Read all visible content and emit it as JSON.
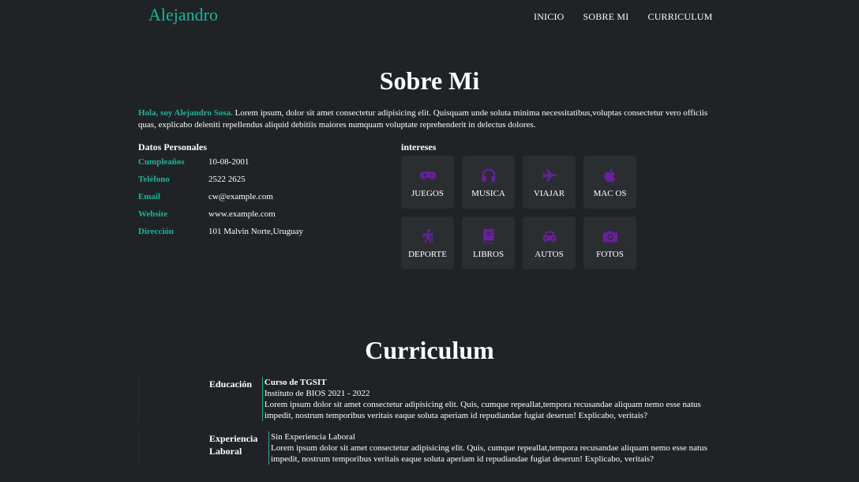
{
  "header": {
    "brand": "Alejandro",
    "nav": [
      "INICIO",
      "SOBRE MI",
      "CURRICULUM"
    ]
  },
  "about": {
    "title": "Sobre Mi",
    "greeting": "Hola, soy Alejandro Sosa.",
    "intro": " Lorem ipsum, dolor sit amet consectetur adipisicing elit. Quisquam unde soluta minima necessitatibus,voluptas consectetur vero officiis quas, explicabo deleniti repellendus aliquid debitiis maiores numquam voluptate reprehenderit in delectus dolores.",
    "personal_heading": "Datos Personales",
    "personal": [
      {
        "key": "Cumpleaños",
        "value": "10-08-2001"
      },
      {
        "key": "Teléfono",
        "value": "2522 2625"
      },
      {
        "key": "Email",
        "value": "cw@example.com"
      },
      {
        "key": "Website",
        "value": "www.example.com"
      },
      {
        "key": "Dirección",
        "value": "101 Malvin Norte,Uruguay"
      }
    ],
    "interests_heading": "intereses",
    "interests": [
      {
        "label": "JUEGOS",
        "icon": "gamepad-icon"
      },
      {
        "label": "MUSICA",
        "icon": "headphones-icon"
      },
      {
        "label": "VIAJAR",
        "icon": "plane-icon"
      },
      {
        "label": "MAC OS",
        "icon": "apple-icon"
      },
      {
        "label": "DEPORTE",
        "icon": "hiking-icon"
      },
      {
        "label": "LIBROS",
        "icon": "book-icon"
      },
      {
        "label": "AUTOS",
        "icon": "car-icon"
      },
      {
        "label": "FOTOS",
        "icon": "camera-icon"
      }
    ],
    "icon_color": "#6a1fa0"
  },
  "curriculum": {
    "title": "Curriculum",
    "education": {
      "label": "Educación",
      "course": "Curso de TGSIT",
      "institute": "Instituto de BIOS 2021 - 2022",
      "text": "Lorem ipsum dolor sit amet consectetur adipisicing elit. Quis, cumque repeallat,tempora recusandae aliquam nemo esse natus impedit, nostrum temporibus veritais eaque soluta aperiam id repudiandae fugiat deserun! Explicabo, veritais?"
    },
    "experience": {
      "label_line1": "Experiencia",
      "label_line2": "Laboral",
      "title": "Sin Experiencia Laboral",
      "text": "Lorem ipsum dolor sit amet consectetur adipisicing elit. Quis, cumque repeallat,tempora recusandae aliquam nemo esse natus impedit, nostrum temporibus veritais eaque soluta aperiam id repudiandae fugiat deserun! Explicabo, veritais?"
    }
  },
  "colors": {
    "accent": "#22b39a",
    "background": "#1f2326",
    "tile": "#2a2e31"
  }
}
